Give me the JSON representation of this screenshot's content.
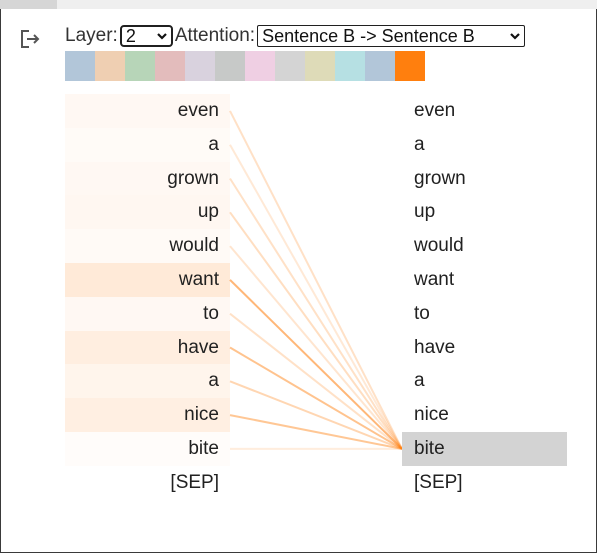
{
  "controls": {
    "layer_label": "Layer:",
    "layer_value": "2",
    "attention_label": "Attention:",
    "attention_value": "Sentence B -> Sentence B"
  },
  "head_colors": [
    "#b2c6d9",
    "#efcfb2",
    "#b7d5b8",
    "#e3bcbc",
    "#d9d2de",
    "#c7c9c8",
    "#efcfe3",
    "#d4d4d4",
    "#dedbb8",
    "#b6e0e3",
    "#b2c6d9",
    "#ff7f0e"
  ],
  "accent": "#ff7f0e",
  "selected_token_index": 10,
  "left_tokens": [
    {
      "text": "even",
      "weight": 0.05
    },
    {
      "text": "a",
      "weight": 0.03
    },
    {
      "text": "grown",
      "weight": 0.05
    },
    {
      "text": "up",
      "weight": 0.06
    },
    {
      "text": "would",
      "weight": 0.04
    },
    {
      "text": "want",
      "weight": 0.16
    },
    {
      "text": "to",
      "weight": 0.05
    },
    {
      "text": "have",
      "weight": 0.13
    },
    {
      "text": "a",
      "weight": 0.08
    },
    {
      "text": "nice",
      "weight": 0.12
    },
    {
      "text": "bite",
      "weight": 0.02
    },
    {
      "text": "[SEP]",
      "weight": 0.0
    }
  ],
  "right_tokens": [
    {
      "text": "even"
    },
    {
      "text": "a"
    },
    {
      "text": "grown"
    },
    {
      "text": "up"
    },
    {
      "text": "would"
    },
    {
      "text": "want"
    },
    {
      "text": "to"
    },
    {
      "text": "have"
    },
    {
      "text": "a"
    },
    {
      "text": "nice"
    },
    {
      "text": "bite"
    },
    {
      "text": "[SEP]"
    }
  ]
}
